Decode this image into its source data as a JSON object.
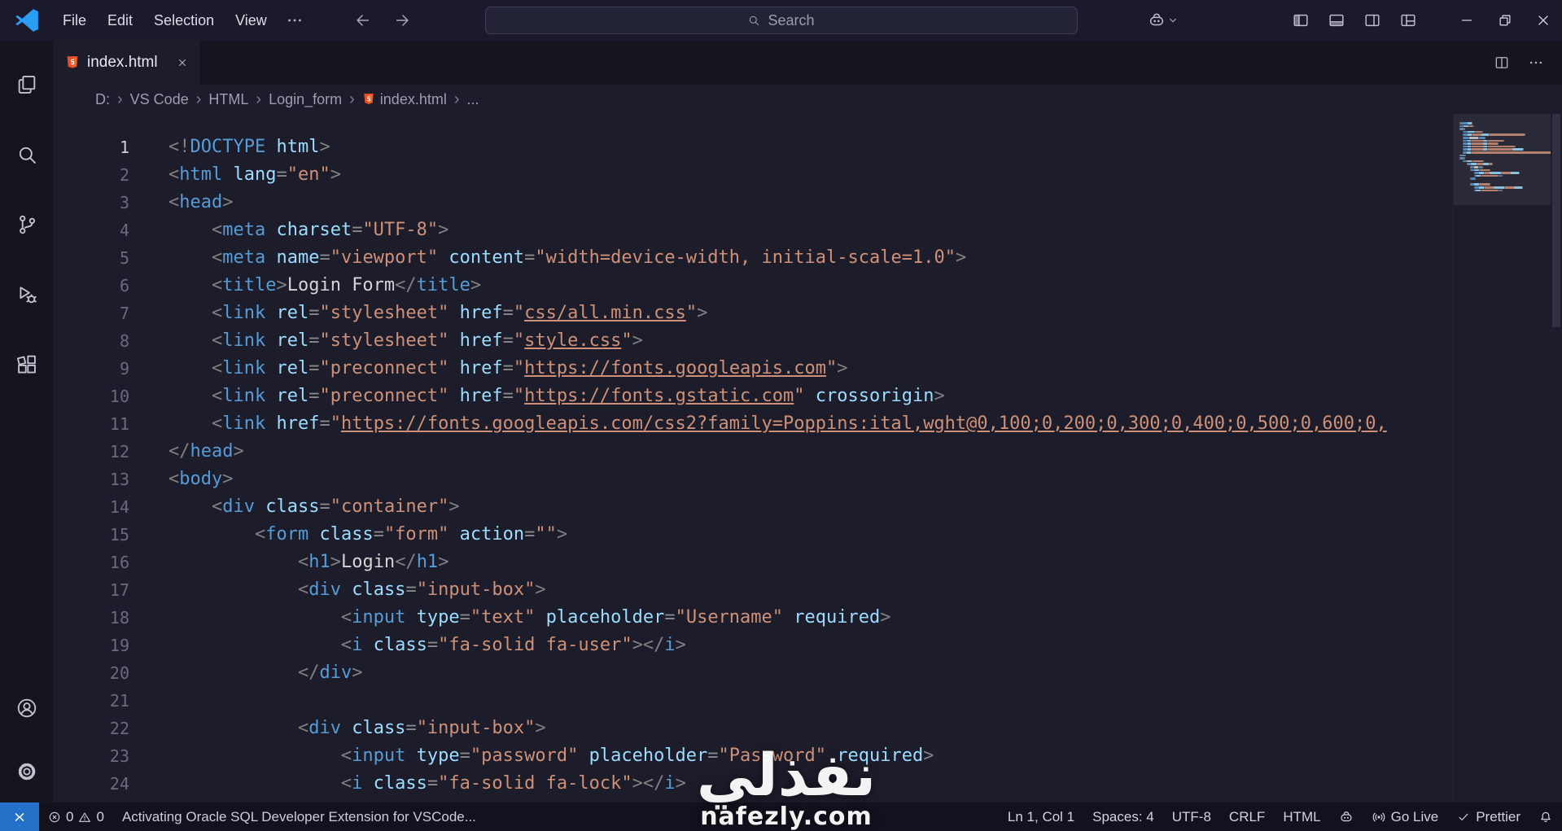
{
  "window": {
    "menus": [
      "File",
      "Edit",
      "Selection",
      "View"
    ],
    "search_placeholder": "Search"
  },
  "colors": {
    "accent_blue": "#2571c9",
    "logo_blue": "#2a9df4",
    "html_icon_orange": "#e44d26",
    "tag": "#569cd6",
    "attribute": "#9cdcfe",
    "string": "#ce9178",
    "punctuation": "#808080"
  },
  "activitybar": {
    "top": [
      {
        "name": "explorer",
        "icon": "explorer-icon"
      },
      {
        "name": "search",
        "icon": "search-icon"
      },
      {
        "name": "source-control",
        "icon": "source-control-icon"
      },
      {
        "name": "run-debug",
        "icon": "run-debug-icon"
      },
      {
        "name": "extensions",
        "icon": "extensions-icon"
      }
    ],
    "bottom": [
      {
        "name": "account",
        "icon": "account-icon"
      },
      {
        "name": "settings",
        "icon": "settings-icon"
      }
    ]
  },
  "tab": {
    "label": "index.html"
  },
  "breadcrumbs": {
    "items": [
      {
        "label": "D:"
      },
      {
        "label": "VS Code"
      },
      {
        "label": "HTML"
      },
      {
        "label": "Login_form"
      },
      {
        "label": "index.html",
        "icon": "html5-icon"
      },
      {
        "label": "..."
      }
    ]
  },
  "editor": {
    "lines": [
      [
        [
          "p",
          "<!"
        ],
        [
          "t",
          "DOCTYPE"
        ],
        [
          "x",
          " "
        ],
        [
          "a",
          "html"
        ],
        [
          "p",
          ">"
        ]
      ],
      [
        [
          "p",
          "<"
        ],
        [
          "t",
          "html"
        ],
        [
          "x",
          " "
        ],
        [
          "a",
          "lang"
        ],
        [
          "o",
          "="
        ],
        [
          "s",
          "\"en\""
        ],
        [
          "p",
          ">"
        ]
      ],
      [
        [
          "p",
          "<"
        ],
        [
          "t",
          "head"
        ],
        [
          "p",
          ">"
        ]
      ],
      [
        [
          "w",
          "    "
        ],
        [
          "p",
          "<"
        ],
        [
          "t",
          "meta"
        ],
        [
          "x",
          " "
        ],
        [
          "a",
          "charset"
        ],
        [
          "o",
          "="
        ],
        [
          "s",
          "\"UTF-8\""
        ],
        [
          "p",
          ">"
        ]
      ],
      [
        [
          "w",
          "    "
        ],
        [
          "p",
          "<"
        ],
        [
          "t",
          "meta"
        ],
        [
          "x",
          " "
        ],
        [
          "a",
          "name"
        ],
        [
          "o",
          "="
        ],
        [
          "s",
          "\"viewport\""
        ],
        [
          "x",
          " "
        ],
        [
          "a",
          "content"
        ],
        [
          "o",
          "="
        ],
        [
          "s",
          "\"width=device-width, initial-scale=1.0\""
        ],
        [
          "p",
          ">"
        ]
      ],
      [
        [
          "w",
          "    "
        ],
        [
          "p",
          "<"
        ],
        [
          "t",
          "title"
        ],
        [
          "p",
          ">"
        ],
        [
          "x",
          "Login Form"
        ],
        [
          "p",
          "</"
        ],
        [
          "t",
          "title"
        ],
        [
          "p",
          ">"
        ]
      ],
      [
        [
          "w",
          "    "
        ],
        [
          "p",
          "<"
        ],
        [
          "t",
          "link"
        ],
        [
          "x",
          " "
        ],
        [
          "a",
          "rel"
        ],
        [
          "o",
          "="
        ],
        [
          "s",
          "\"stylesheet\""
        ],
        [
          "x",
          " "
        ],
        [
          "a",
          "href"
        ],
        [
          "o",
          "="
        ],
        [
          "s",
          "\""
        ],
        [
          "l",
          "css/all.min.css"
        ],
        [
          "s",
          "\""
        ],
        [
          "p",
          ">"
        ]
      ],
      [
        [
          "w",
          "    "
        ],
        [
          "p",
          "<"
        ],
        [
          "t",
          "link"
        ],
        [
          "x",
          " "
        ],
        [
          "a",
          "rel"
        ],
        [
          "o",
          "="
        ],
        [
          "s",
          "\"stylesheet\""
        ],
        [
          "x",
          " "
        ],
        [
          "a",
          "href"
        ],
        [
          "o",
          "="
        ],
        [
          "s",
          "\""
        ],
        [
          "l",
          "style.css"
        ],
        [
          "s",
          "\""
        ],
        [
          "p",
          ">"
        ]
      ],
      [
        [
          "w",
          "    "
        ],
        [
          "p",
          "<"
        ],
        [
          "t",
          "link"
        ],
        [
          "x",
          " "
        ],
        [
          "a",
          "rel"
        ],
        [
          "o",
          "="
        ],
        [
          "s",
          "\"preconnect\""
        ],
        [
          "x",
          " "
        ],
        [
          "a",
          "href"
        ],
        [
          "o",
          "="
        ],
        [
          "s",
          "\""
        ],
        [
          "l",
          "https://fonts.googleapis.com"
        ],
        [
          "s",
          "\""
        ],
        [
          "p",
          ">"
        ]
      ],
      [
        [
          "w",
          "    "
        ],
        [
          "p",
          "<"
        ],
        [
          "t",
          "link"
        ],
        [
          "x",
          " "
        ],
        [
          "a",
          "rel"
        ],
        [
          "o",
          "="
        ],
        [
          "s",
          "\"preconnect\""
        ],
        [
          "x",
          " "
        ],
        [
          "a",
          "href"
        ],
        [
          "o",
          "="
        ],
        [
          "s",
          "\""
        ],
        [
          "l",
          "https://fonts.gstatic.com"
        ],
        [
          "s",
          "\""
        ],
        [
          "x",
          " "
        ],
        [
          "a",
          "crossorigin"
        ],
        [
          "p",
          ">"
        ]
      ],
      [
        [
          "w",
          "    "
        ],
        [
          "p",
          "<"
        ],
        [
          "t",
          "link"
        ],
        [
          "x",
          " "
        ],
        [
          "a",
          "href"
        ],
        [
          "o",
          "="
        ],
        [
          "s",
          "\""
        ],
        [
          "l",
          "https://fonts.googleapis.com/css2?family=Poppins:ital,wght@0,100;0,200;0,300;0,400;0,500;0,600;0,"
        ]
      ],
      [
        [
          "p",
          "</"
        ],
        [
          "t",
          "head"
        ],
        [
          "p",
          ">"
        ]
      ],
      [
        [
          "p",
          "<"
        ],
        [
          "t",
          "body"
        ],
        [
          "p",
          ">"
        ]
      ],
      [
        [
          "w",
          "    "
        ],
        [
          "p",
          "<"
        ],
        [
          "t",
          "div"
        ],
        [
          "x",
          " "
        ],
        [
          "a",
          "class"
        ],
        [
          "o",
          "="
        ],
        [
          "s",
          "\"container\""
        ],
        [
          "p",
          ">"
        ]
      ],
      [
        [
          "w",
          "        "
        ],
        [
          "p",
          "<"
        ],
        [
          "t",
          "form"
        ],
        [
          "x",
          " "
        ],
        [
          "a",
          "class"
        ],
        [
          "o",
          "="
        ],
        [
          "s",
          "\"form\""
        ],
        [
          "x",
          " "
        ],
        [
          "a",
          "action"
        ],
        [
          "o",
          "="
        ],
        [
          "s",
          "\"\""
        ],
        [
          "p",
          ">"
        ]
      ],
      [
        [
          "w",
          "            "
        ],
        [
          "p",
          "<"
        ],
        [
          "t",
          "h1"
        ],
        [
          "p",
          ">"
        ],
        [
          "x",
          "Login"
        ],
        [
          "p",
          "</"
        ],
        [
          "t",
          "h1"
        ],
        [
          "p",
          ">"
        ]
      ],
      [
        [
          "w",
          "            "
        ],
        [
          "p",
          "<"
        ],
        [
          "t",
          "div"
        ],
        [
          "x",
          " "
        ],
        [
          "a",
          "class"
        ],
        [
          "o",
          "="
        ],
        [
          "s",
          "\"input-box\""
        ],
        [
          "p",
          ">"
        ]
      ],
      [
        [
          "w",
          "                "
        ],
        [
          "p",
          "<"
        ],
        [
          "t",
          "input"
        ],
        [
          "x",
          " "
        ],
        [
          "a",
          "type"
        ],
        [
          "o",
          "="
        ],
        [
          "s",
          "\"text\""
        ],
        [
          "x",
          " "
        ],
        [
          "a",
          "placeholder"
        ],
        [
          "o",
          "="
        ],
        [
          "s",
          "\"Username\""
        ],
        [
          "x",
          " "
        ],
        [
          "a",
          "required"
        ],
        [
          "p",
          ">"
        ]
      ],
      [
        [
          "w",
          "                "
        ],
        [
          "p",
          "<"
        ],
        [
          "t",
          "i"
        ],
        [
          "x",
          " "
        ],
        [
          "a",
          "class"
        ],
        [
          "o",
          "="
        ],
        [
          "s",
          "\"fa-solid fa-user\""
        ],
        [
          "p",
          ">"
        ],
        [
          "p",
          "</"
        ],
        [
          "t",
          "i"
        ],
        [
          "p",
          ">"
        ]
      ],
      [
        [
          "w",
          "            "
        ],
        [
          "p",
          "</"
        ],
        [
          "t",
          "div"
        ],
        [
          "p",
          ">"
        ]
      ],
      [],
      [
        [
          "w",
          "            "
        ],
        [
          "p",
          "<"
        ],
        [
          "t",
          "div"
        ],
        [
          "x",
          " "
        ],
        [
          "a",
          "class"
        ],
        [
          "o",
          "="
        ],
        [
          "s",
          "\"input-box\""
        ],
        [
          "p",
          ">"
        ]
      ],
      [
        [
          "w",
          "                "
        ],
        [
          "p",
          "<"
        ],
        [
          "t",
          "input"
        ],
        [
          "x",
          " "
        ],
        [
          "a",
          "type"
        ],
        [
          "o",
          "="
        ],
        [
          "s",
          "\"password\""
        ],
        [
          "x",
          " "
        ],
        [
          "a",
          "placeholder"
        ],
        [
          "o",
          "="
        ],
        [
          "s",
          "\"Password\""
        ],
        [
          "x",
          " "
        ],
        [
          "a",
          "required"
        ],
        [
          "p",
          ">"
        ]
      ],
      [
        [
          "w",
          "                "
        ],
        [
          "p",
          "<"
        ],
        [
          "t",
          "i"
        ],
        [
          "x",
          " "
        ],
        [
          "a",
          "class"
        ],
        [
          "o",
          "="
        ],
        [
          "s",
          "\"fa-solid fa-lock\""
        ],
        [
          "p",
          ">"
        ],
        [
          "p",
          "</"
        ],
        [
          "t",
          "i"
        ],
        [
          "p",
          ">"
        ]
      ]
    ]
  },
  "statusbar": {
    "errors": "0",
    "warnings": "0",
    "message": "Activating Oracle SQL Developer Extension for VSCode...",
    "items_right": [
      {
        "name": "cursor-position",
        "label": "Ln 1, Col 1"
      },
      {
        "name": "indentation",
        "label": "Spaces: 4"
      },
      {
        "name": "encoding",
        "label": "UTF-8"
      },
      {
        "name": "eol",
        "label": "CRLF"
      },
      {
        "name": "language-mode",
        "label": "HTML"
      },
      {
        "name": "copilot",
        "label": "",
        "icon": "copilot-icon"
      },
      {
        "name": "go-live",
        "label": "Go Live",
        "icon": "broadcast-icon"
      },
      {
        "name": "prettier",
        "label": "Prettier",
        "icon": "check-icon"
      },
      {
        "name": "notifications",
        "label": "",
        "icon": "bell-icon"
      }
    ]
  },
  "watermark": {
    "arabic": "نفذلي",
    "site": "nafezly.com"
  }
}
